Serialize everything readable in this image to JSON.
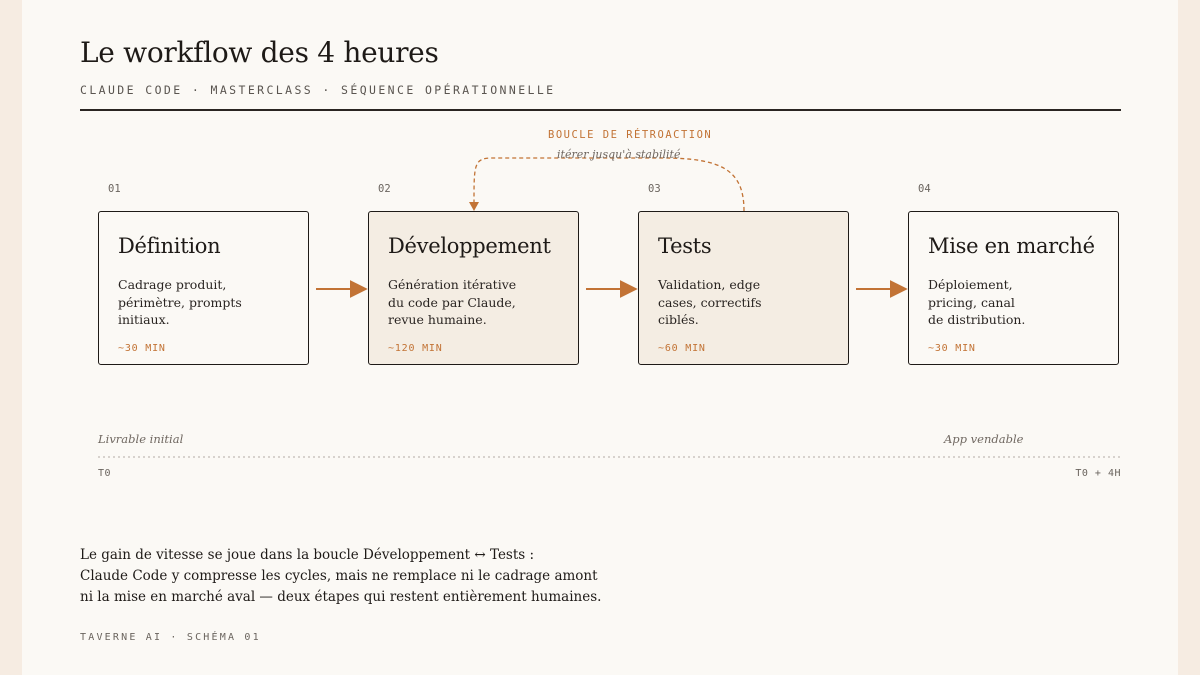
{
  "header": {
    "title": "Le workflow des 4 heures",
    "subtitle": "CLAUDE CODE · MASTERCLASS · SÉQUENCE OPÉRATIONNELLE"
  },
  "feedback_loop": {
    "label": "BOUCLE DE RÉTROACTION",
    "sublabel": "itérer jusqu'à stabilité"
  },
  "steps": [
    {
      "number": "01",
      "title": "Définition",
      "description": "Cadrage produit,\npérimètre, prompts\ninitiaux.",
      "duration": "~30 MIN"
    },
    {
      "number": "02",
      "title": "Développement",
      "description": "Génération itérative\ndu code par Claude,\nrevue humaine.",
      "duration": "~120 MIN"
    },
    {
      "number": "03",
      "title": "Tests",
      "description": "Validation, edge\ncases, correctifs\nciblés.",
      "duration": "~60 MIN"
    },
    {
      "number": "04",
      "title": "Mise en marché",
      "description": "Déploiement,\npricing, canal\nde distribution.",
      "duration": "~30 MIN"
    }
  ],
  "timeline": {
    "start_label": "Livrable initial",
    "end_label": "App vendable",
    "start_tick": "T0",
    "end_tick": "T0 + 4H"
  },
  "conclusion": "Le gain de vitesse se joue dans la boucle Développement ↔ Tests :\nClaude Code y compresse les cycles, mais ne remplace ni le cadrage amont\nni la mise en marché aval — deux étapes qui restent entièrement humaines.",
  "footer": "TAVERNE AI · SCHÉMA 01",
  "colors": {
    "accent": "#c27335",
    "ink": "#1e1a17",
    "paper": "#fbf9f5",
    "highlight": "#f4ede3",
    "frame": "#f6ece2"
  }
}
